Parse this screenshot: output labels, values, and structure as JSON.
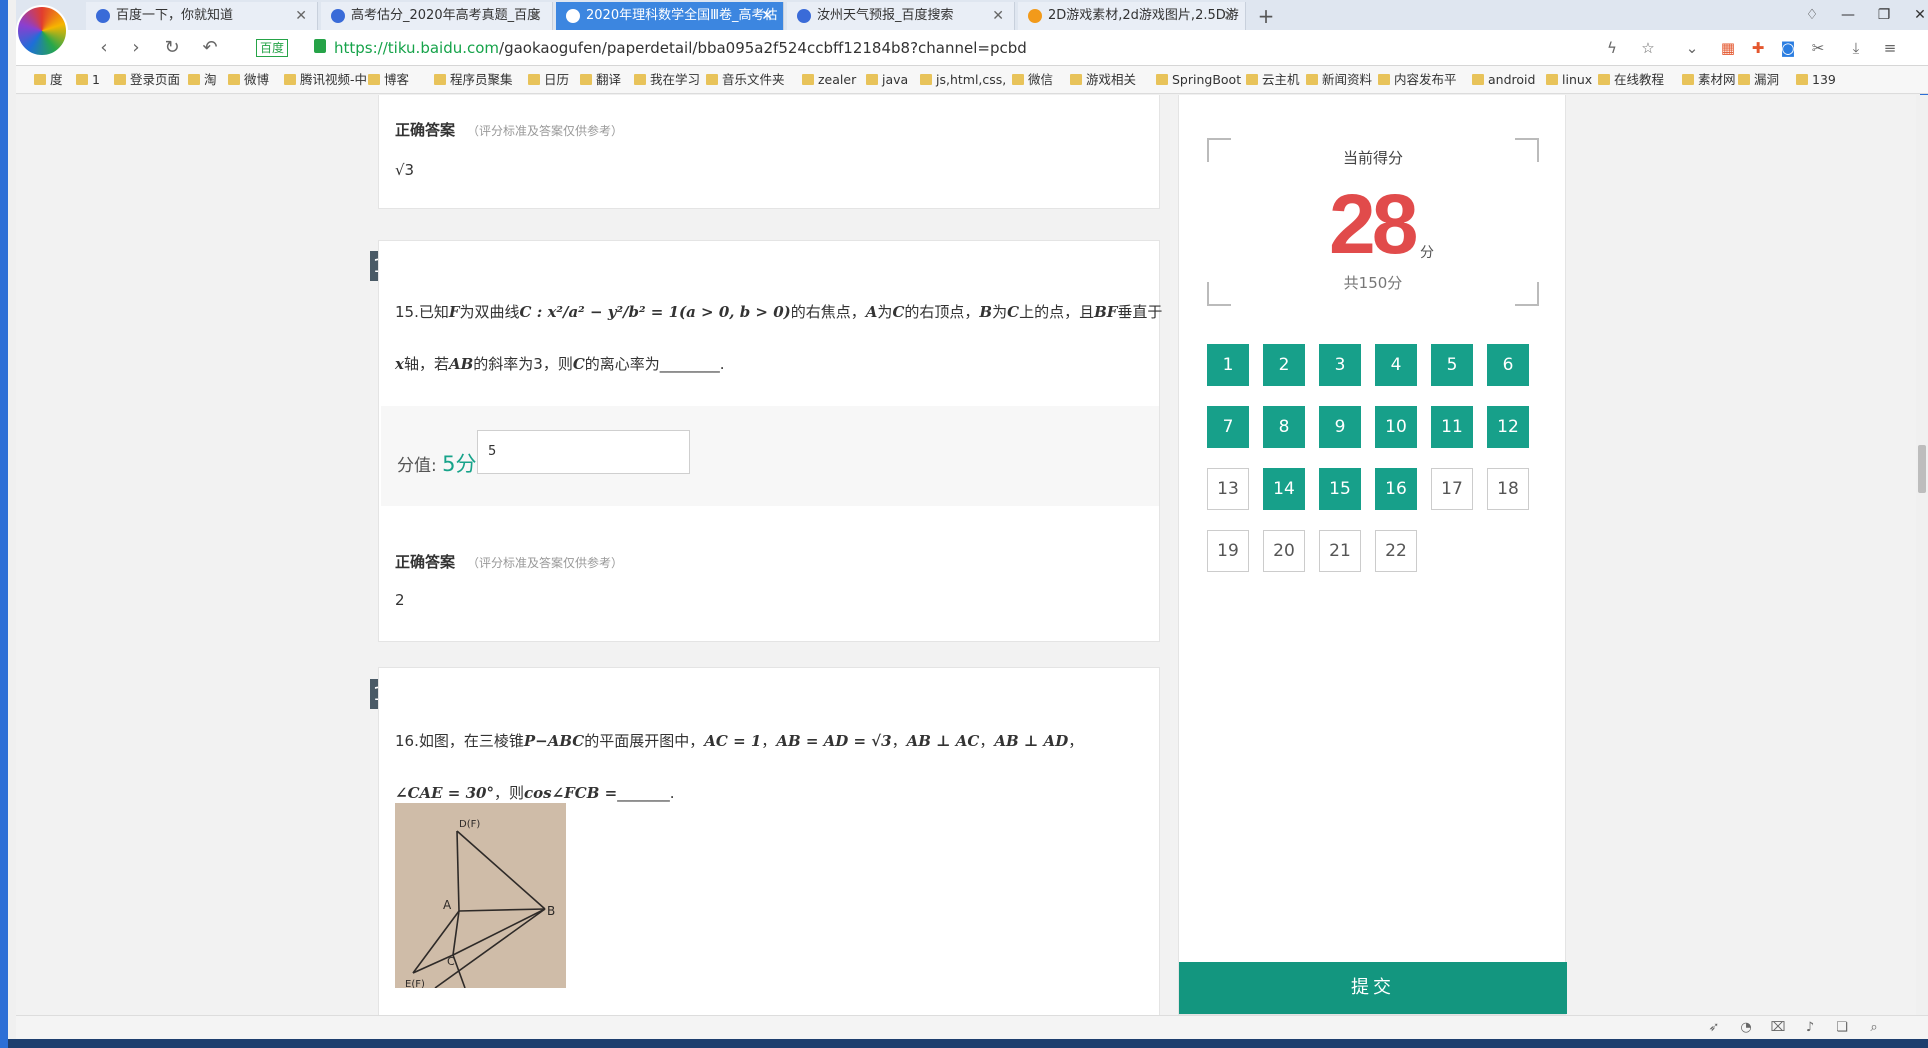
{
  "browser": {
    "tabs": [
      {
        "title": "百度一下，你就知道"
      },
      {
        "title": "高考估分_2020年高考真题_百度"
      },
      {
        "title": "2020年理科数学全国Ⅲ卷_高考估"
      },
      {
        "title": "汝州天气预报_百度搜索"
      },
      {
        "title": "2D游戏素材,2d游戏图片,2.5D游"
      }
    ],
    "active_tab": 2,
    "verified_label": "百度",
    "url_host": "https://tiku.baidu.com",
    "url_path": "/gaokaogufen/paperdetail/bba095a2f524ccbff12184b8?channel=pcbd"
  },
  "bookmarks": [
    "度",
    "1",
    "登录页面",
    "淘",
    "微博",
    "腾讯视频-中",
    "博客",
    "程序员聚集",
    "日历",
    "翻译",
    "我在学习",
    "音乐文件夹",
    "zealer",
    "java",
    "js,html,css,",
    "微信",
    "游戏相关",
    "SpringBoot",
    "云主机",
    "新闻资料",
    "内容发布平",
    "android",
    "linux",
    "在线教程",
    "素材网",
    "漏洞",
    "139"
  ],
  "top_card": {
    "answer_heading": "正确答案",
    "answer_note": "（评分标准及答案仅供参考）",
    "answer": "√3"
  },
  "q15": {
    "number": "15",
    "line1_prefix": "15.已知",
    "line1_F": "F",
    "line1_a": "为双曲线",
    "line1_formula": "C : x²/a² − y²/b² = 1(a > 0, b > 0)",
    "line1_b": "的右焦点，",
    "line1_A": "A",
    "line1_c": "为",
    "line1_C": "C",
    "line1_d": "的右顶点，",
    "line1_B": "B",
    "line1_e": "为",
    "line1_C2": "C",
    "line1_f": "上的点，且",
    "line1_BF": "BF",
    "line1_g": "垂直于",
    "line2_x": "x",
    "line2_a": "轴，若",
    "line2_AB": "AB",
    "line2_b": "的斜率为3，则",
    "line2_C": "C",
    "line2_c": "的离心率为________.",
    "score_label": "分值:",
    "score_value": "5分",
    "score_input": "5",
    "answer_heading": "正确答案",
    "answer_note": "（评分标准及答案仅供参考）",
    "answer": "2"
  },
  "q16": {
    "number": "16",
    "line1_a": "16.如图，在三棱锥",
    "line1_P": "P−ABC",
    "line1_b": "的平面展开图中，",
    "line1_AC": "AC = 1",
    "line1_c": "，",
    "line1_AB": "AB = AD = √3",
    "line1_d": "，",
    "line1_perp1": "AB ⊥ AC",
    "line1_e": "，",
    "line1_perp2": "AB ⊥ AD",
    "line1_f": "，",
    "line2_angle": "∠CAE = 30°",
    "line2_a": "，则",
    "line2_cos": "cos∠FCB =",
    "line2_b": "_______.",
    "figure_labels": {
      "top": "D(F)",
      "left": "A",
      "right": "B",
      "mid": "C",
      "bottom": "E(F)"
    }
  },
  "sidebar": {
    "current_label": "当前得分",
    "score": "28",
    "score_unit": "分",
    "total": "共150分",
    "questions": [
      {
        "n": "1",
        "done": true
      },
      {
        "n": "2",
        "done": true
      },
      {
        "n": "3",
        "done": true
      },
      {
        "n": "4",
        "done": true
      },
      {
        "n": "5",
        "done": true
      },
      {
        "n": "6",
        "done": true
      },
      {
        "n": "7",
        "done": true
      },
      {
        "n": "8",
        "done": true
      },
      {
        "n": "9",
        "done": true
      },
      {
        "n": "10",
        "done": true
      },
      {
        "n": "11",
        "done": true
      },
      {
        "n": "12",
        "done": true
      },
      {
        "n": "13",
        "done": false
      },
      {
        "n": "14",
        "done": true
      },
      {
        "n": "15",
        "done": true
      },
      {
        "n": "16",
        "done": true
      },
      {
        "n": "17",
        "done": false
      },
      {
        "n": "18",
        "done": false
      },
      {
        "n": "19",
        "done": false
      },
      {
        "n": "20",
        "done": false
      },
      {
        "n": "21",
        "done": false
      },
      {
        "n": "22",
        "done": false
      }
    ],
    "submit_label": "提交"
  },
  "colors": {
    "accent": "#13967f",
    "score": "#e14b4b",
    "tab_active": "#3c86e0"
  }
}
